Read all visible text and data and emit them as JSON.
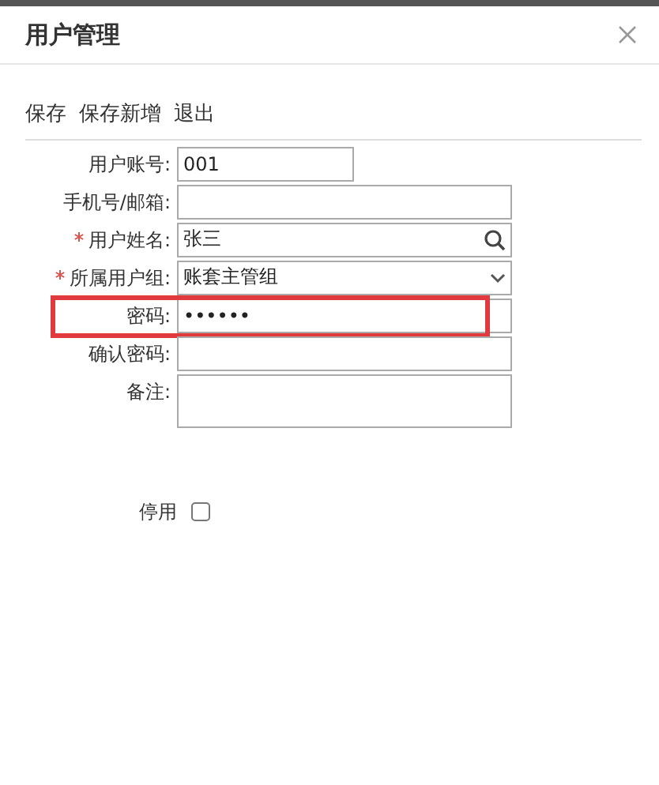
{
  "dialog": {
    "title": "用户管理"
  },
  "toolbar": [
    "保存",
    "保存新增",
    "退出"
  ],
  "fields": [
    {
      "label": "用户账号:",
      "kind": "text",
      "required": false,
      "value": "001",
      "short": true,
      "highlighted": false
    },
    {
      "label": "手机号/邮箱:",
      "kind": "text",
      "required": false,
      "short": false,
      "highlighted": false
    },
    {
      "label": "用户姓名:",
      "kind": "search",
      "required": true,
      "value": "张三",
      "short": false,
      "highlighted": false
    },
    {
      "label": "所属用户组:",
      "kind": "select",
      "required": true,
      "value": "账套主管组",
      "short": false,
      "highlighted": false
    },
    {
      "label": "密码:",
      "kind": "password",
      "required": false,
      "value": "••••••",
      "short": false,
      "highlighted": true
    },
    {
      "label": "确认密码:",
      "kind": "password",
      "required": false,
      "short": false,
      "highlighted": false
    },
    {
      "label": "备注:",
      "kind": "textarea",
      "required": false,
      "short": false,
      "highlighted": false
    }
  ],
  "disable_option": {
    "label": "停用",
    "checked": false
  }
}
